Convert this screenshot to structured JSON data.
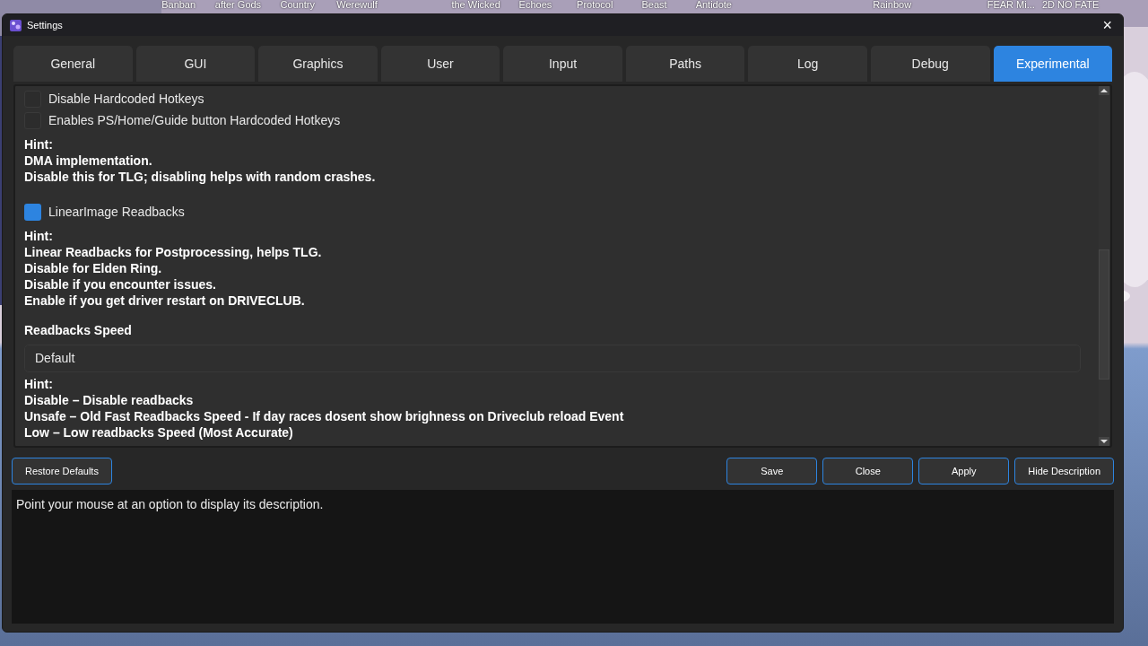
{
  "desktop": {
    "icon_labels": [
      "Banban",
      "after Gods",
      "Country",
      "Werewulf",
      "the Wicked",
      "Echoes",
      "Protocol",
      "Beast",
      "Antidote",
      "Rainbow",
      "FEAR Mi...",
      "2D NO FATE"
    ]
  },
  "window": {
    "title": "Settings",
    "close": "×"
  },
  "tabs": [
    {
      "label": "General",
      "selected": false
    },
    {
      "label": "GUI",
      "selected": false
    },
    {
      "label": "Graphics",
      "selected": false
    },
    {
      "label": "User",
      "selected": false
    },
    {
      "label": "Input",
      "selected": false
    },
    {
      "label": "Paths",
      "selected": false
    },
    {
      "label": "Log",
      "selected": false
    },
    {
      "label": "Debug",
      "selected": false
    },
    {
      "label": "Experimental",
      "selected": true
    }
  ],
  "content": [
    {
      "kind": "checkbox",
      "label": "Disable Hardcoded Hotkeys",
      "checked": false
    },
    {
      "kind": "checkbox",
      "label": "Enables PS/Home/Guide button Hardcoded Hotkeys",
      "checked": false
    },
    {
      "kind": "hint",
      "lines": [
        "Hint:",
        "DMA implementation.",
        "Disable this for TLG; disabling helps with random crashes."
      ]
    },
    {
      "kind": "checkbox",
      "label": "LinearImage Readbacks",
      "checked": true
    },
    {
      "kind": "hint",
      "lines": [
        "Hint:",
        "Linear Readbacks for Postprocessing, helps TLG.",
        "Disable for Elden Ring.",
        "Disable if you encounter issues.",
        "Enable if you get driver restart on DRIVECLUB."
      ]
    },
    {
      "kind": "select",
      "label": "Readbacks Speed",
      "value": "Default"
    },
    {
      "kind": "hint",
      "lines": [
        "Hint:",
        "Disable – Disable readbacks",
        "Unsafe – Old Fast Readbacks Speed - If day races dosent show brighness on Driveclub reload Event",
        "Low – Low readbacks Speed (Most Accurate)"
      ]
    }
  ],
  "buttons": {
    "left": [
      "Restore Defaults"
    ],
    "right": [
      "Save",
      "Close",
      "Apply",
      "Hide Description"
    ]
  },
  "description": "Point your mouse at an option to display its description."
}
